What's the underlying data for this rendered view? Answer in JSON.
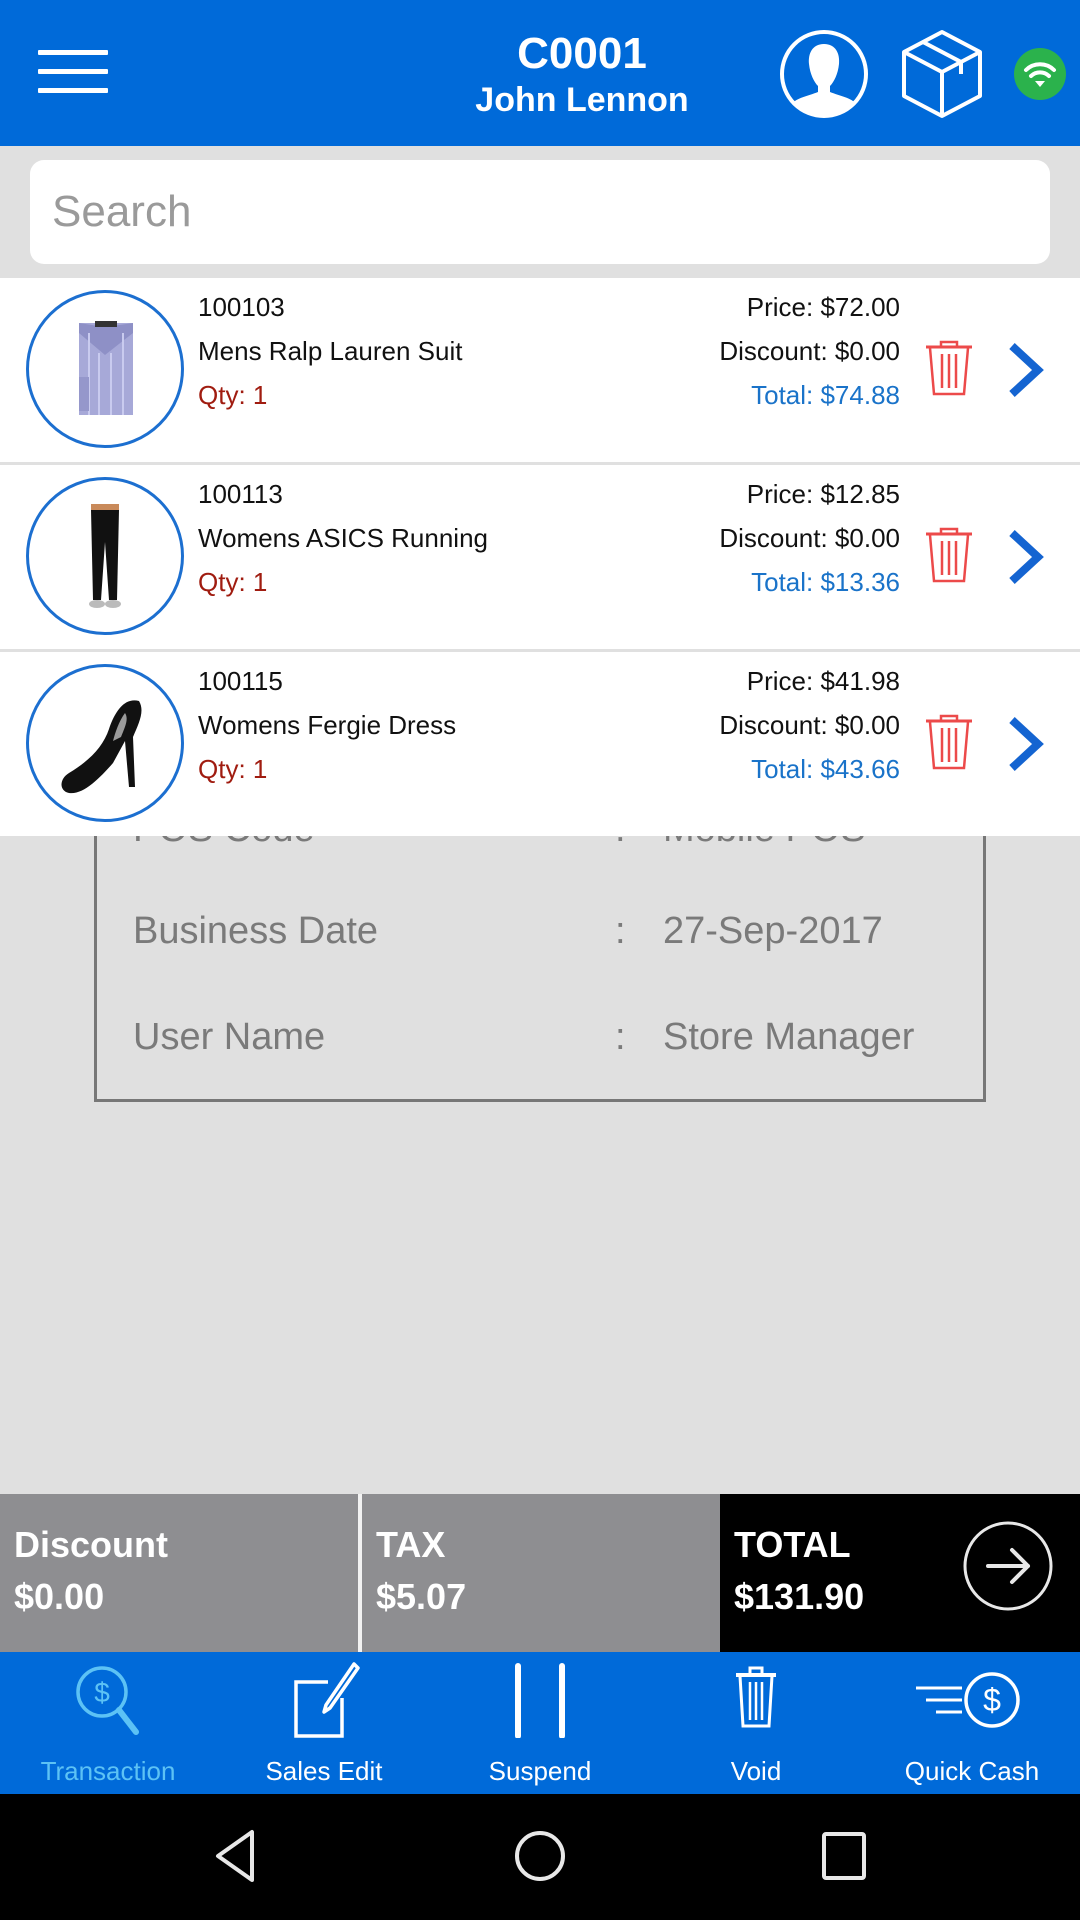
{
  "header": {
    "customer_code": "C0001",
    "customer_name": "John Lennon",
    "icons": [
      "menu-icon",
      "customer-icon",
      "package-icon",
      "wifi-status-icon"
    ],
    "wifi_status_color": "#2bb24c",
    "brand_color": "#006ad9"
  },
  "search": {
    "placeholder": "Search",
    "value": ""
  },
  "items": [
    {
      "sku": "100103",
      "name": "Mens Ralp Lauren Suit",
      "qty": "Qty: 1",
      "price": "Price: $72.00",
      "discount": "Discount: $0.00",
      "total": "Total: $74.88",
      "image": "shirt"
    },
    {
      "sku": "100113",
      "name": "Womens ASICS Running",
      "qty": "Qty: 1",
      "price": "Price: $12.85",
      "discount": "Discount: $0.00",
      "total": "Total: $13.36",
      "image": "pants"
    },
    {
      "sku": "100115",
      "name": "Womens Fergie Dress",
      "qty": "Qty: 1",
      "price": "Price: $41.98",
      "discount": "Discount: $0.00",
      "total": "Total: $43.66",
      "image": "heel-shoe"
    }
  ],
  "info_panel": {
    "rows": [
      {
        "label": "POS Code",
        "colon": ":",
        "value": "Mobile POS"
      },
      {
        "label": "Business Date",
        "colon": ":",
        "value": "27-Sep-2017"
      },
      {
        "label": "User Name",
        "colon": ":",
        "value": "Store Manager"
      }
    ]
  },
  "summary": {
    "discount_label": "Discount",
    "discount_value": "$0.00",
    "tax_label": "TAX",
    "tax_value": "$5.07",
    "total_label": "TOTAL",
    "total_value": "$131.90"
  },
  "bottom_nav": {
    "items": [
      {
        "label": "Transaction",
        "icon": "transaction-search-icon",
        "active": true
      },
      {
        "label": "Sales Edit",
        "icon": "edit-icon",
        "active": false
      },
      {
        "label": "Suspend",
        "icon": "pause-icon",
        "active": false
      },
      {
        "label": "Void",
        "icon": "trash-icon",
        "active": false
      },
      {
        "label": "Quick Cash",
        "icon": "quick-cash-icon",
        "active": false
      }
    ],
    "active_color": "#5cc2f5"
  },
  "system_nav": {
    "icons": [
      "back-icon",
      "home-icon",
      "recents-icon"
    ]
  }
}
